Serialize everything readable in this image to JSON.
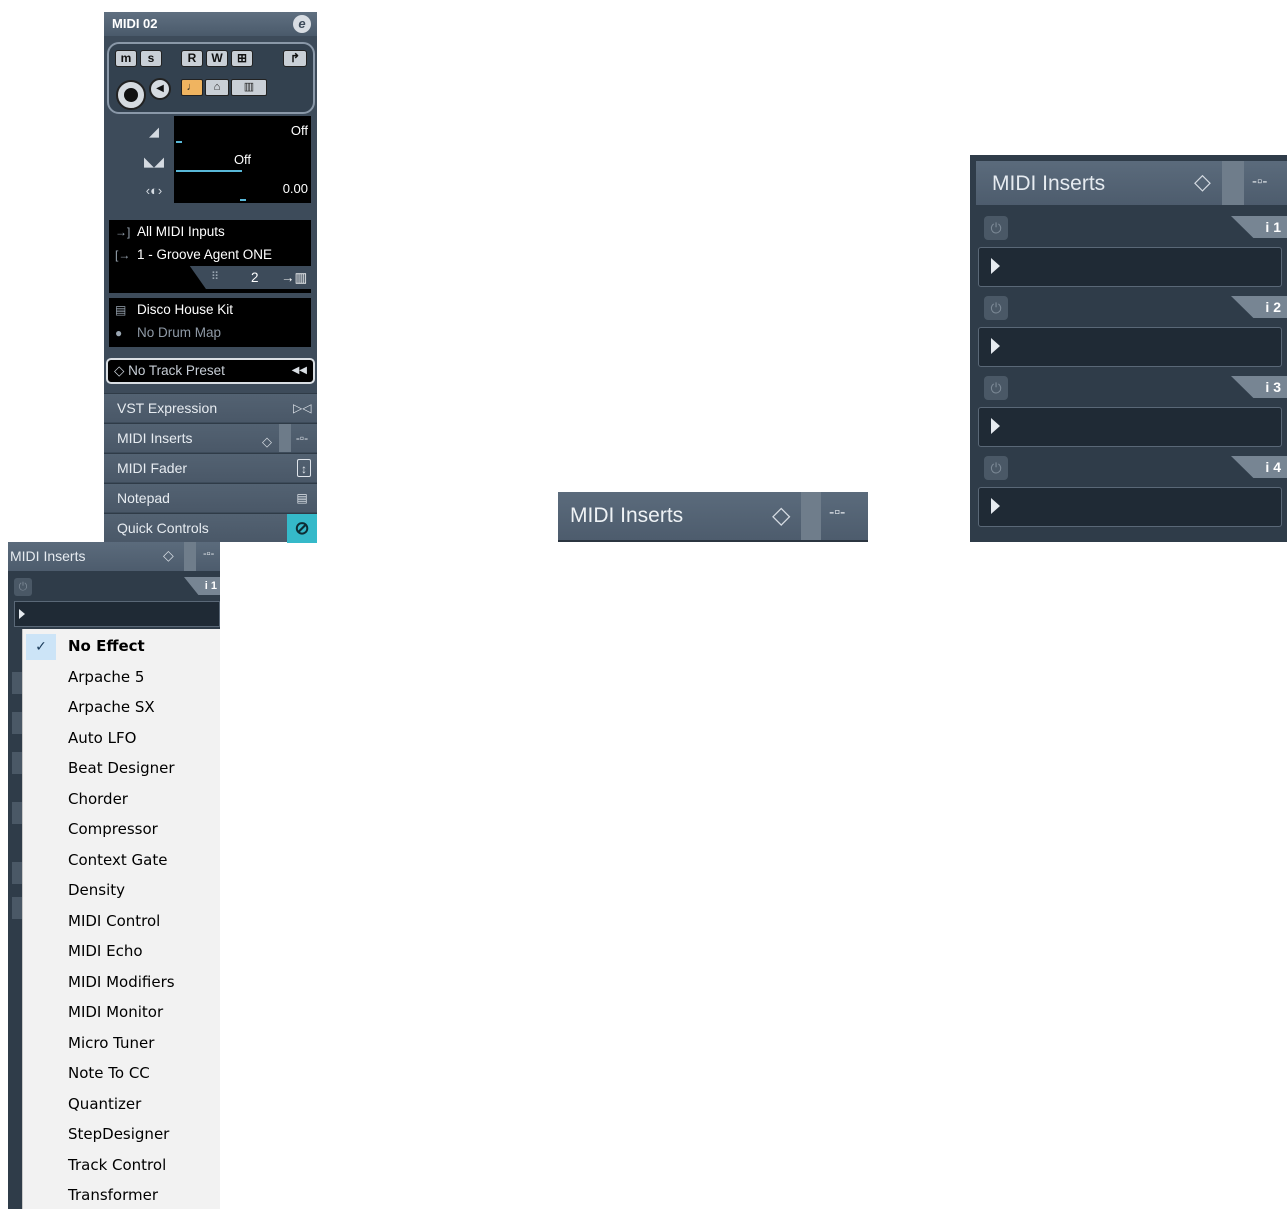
{
  "inspector": {
    "track_name": "MIDI 02",
    "edit_icon": "e",
    "buttons": {
      "mute": "m",
      "solo": "s",
      "read": "R",
      "write": "W",
      "edit_in_place": "⊞",
      "freeze": "↱"
    },
    "volume_value": "Off",
    "transpose_value": "Off",
    "pan_value": "0.00",
    "input": "All MIDI Inputs",
    "output": "1 - Groove Agent ONE",
    "channel": "2",
    "drum_kit": "Disco House Kit",
    "drum_map": "No Drum Map",
    "track_preset": "No Track Preset",
    "sections": [
      {
        "label": "VST Expression"
      },
      {
        "label": "MIDI Inserts"
      },
      {
        "label": "MIDI Fader"
      },
      {
        "label": "Notepad"
      },
      {
        "label": "Quick Controls"
      }
    ],
    "accent_color": "#35b9c9"
  },
  "center_header": {
    "label": "MIDI Inserts"
  },
  "right_panel": {
    "label": "MIDI Inserts",
    "slots": [
      {
        "tab": "i 1"
      },
      {
        "tab": "i 2"
      },
      {
        "tab": "i 3"
      },
      {
        "tab": "i 4"
      }
    ]
  },
  "popup_panel": {
    "label": "MIDI Inserts",
    "slot_tab": "i 1",
    "menu": {
      "checkmark": "✓",
      "items": [
        "No Effect",
        "Arpache 5",
        "Arpache SX",
        "Auto LFO",
        "Beat Designer",
        "Chorder",
        "Compressor",
        "Context Gate",
        "Density",
        "MIDI Control",
        "MIDI Echo",
        "MIDI Modifiers",
        "MIDI Monitor",
        "Micro Tuner",
        "Note To CC",
        "Quantizer",
        "StepDesigner",
        "Track Control",
        "Transformer"
      ],
      "selected": "No Effect"
    }
  }
}
